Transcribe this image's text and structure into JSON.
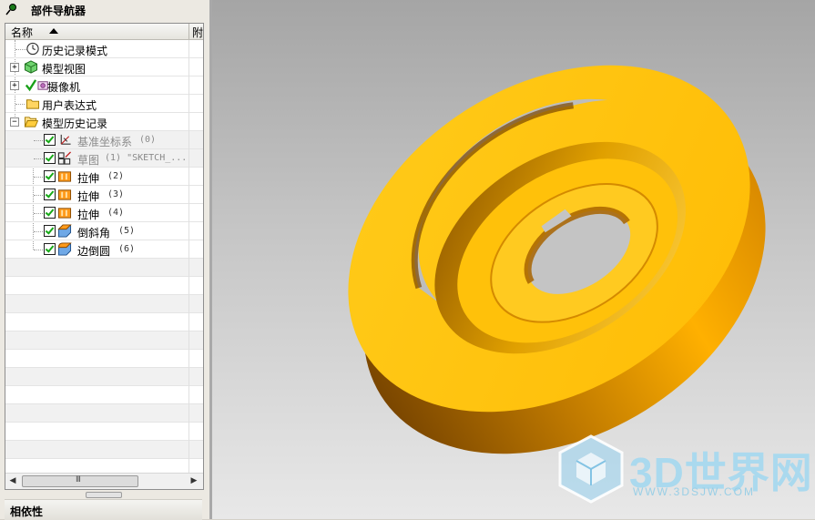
{
  "panel": {
    "title": "部件导航器",
    "header_name": "名称",
    "header_col2": "附",
    "bottom_label": "相依性"
  },
  "tree": [
    {
      "label": "历史记录模式",
      "icon": "clock-icon"
    },
    {
      "label": "模型视图",
      "icon": "model-views-icon"
    },
    {
      "label": "摄像机",
      "icon": "camera-icon"
    },
    {
      "label": "用户表达式",
      "icon": "folder-icon"
    },
    {
      "label": "模型历史记录",
      "icon": "folder-open-icon"
    },
    {
      "label": "基准坐标系",
      "num": "(0)",
      "icon": "datum-csys-icon"
    },
    {
      "label": "草图",
      "num": "(1) \"SKETCH_...",
      "icon": "sketch-icon"
    },
    {
      "label": "拉伸",
      "num": "(2)",
      "icon": "extrude-icon"
    },
    {
      "label": "拉伸",
      "num": "(3)",
      "icon": "extrude-icon"
    },
    {
      "label": "拉伸",
      "num": "(4)",
      "icon": "extrude-icon"
    },
    {
      "label": "倒斜角",
      "num": "(5)",
      "icon": "chamfer-icon"
    },
    {
      "label": "边倒圆",
      "num": "(6)",
      "icon": "edge-blend-icon"
    }
  ],
  "scrollbar": {
    "grip": "III"
  },
  "watermark": {
    "text": "3D世界网",
    "url": "WWW.3DSJW.COM"
  },
  "colors": {
    "model_face": "#ffc20e",
    "model_side": "#e08a00",
    "model_shadow": "#8a5200",
    "checkbox_check": "#16a916",
    "viewport_top": "#a5a5a5",
    "viewport_bottom": "#e8e8e8"
  }
}
